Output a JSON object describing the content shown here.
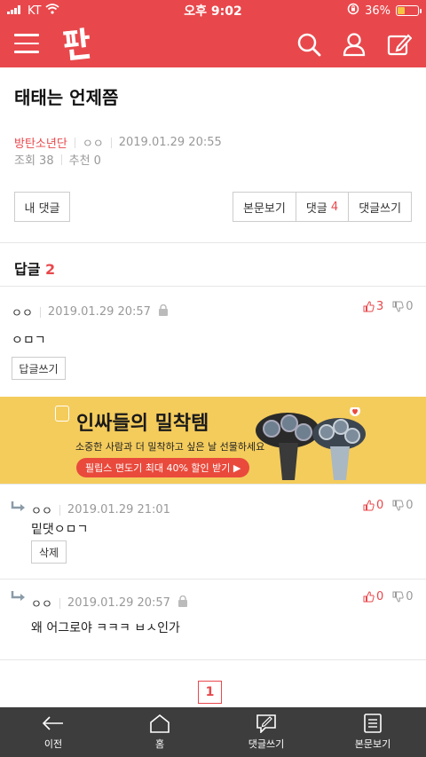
{
  "status": {
    "carrier": "KT",
    "time": "오후 9:02",
    "battery": "36%",
    "battery_level": 0.36
  },
  "post": {
    "title": "태태는 언제쯤",
    "category": "방탄소년단",
    "author": "ㅇㅇ",
    "datetime": "2019.01.29 20:55",
    "views": "조회 38",
    "recommends": "추천 0"
  },
  "actions": {
    "my_comments": "내 댓글",
    "view_post": "본문보기",
    "comments_label": "댓글",
    "comments_count": "4",
    "write_comment": "댓글쓰기"
  },
  "replies": {
    "label": "답글",
    "count": "2"
  },
  "comments": [
    {
      "author": "ㅇㅇ",
      "date": "2019.01.29 20:57",
      "up": "3",
      "down": "0",
      "body": "ㅇㅁㄱ",
      "button": "답글쓰기"
    },
    {
      "author": "ㅇㅇ",
      "date": "2019.01.29 21:01",
      "up": "0",
      "down": "0",
      "body": "밑댓ㅇㅁㄱ",
      "button": "삭제"
    },
    {
      "author": "ㅇㅇ",
      "date": "2019.01.29 20:57",
      "up": "0",
      "down": "0",
      "body": "왜 어그로야 ㅋㅋㅋ ㅂㅅ인가"
    }
  ],
  "ad": {
    "title": "인싸들의 밀착템",
    "subtitle": "소중한 사람과 더 밀착하고 싶은 날 선물하세요",
    "cta": "필립스 면도기 최대 40% 할인 받기 ▶"
  },
  "pagination": {
    "current": "1"
  },
  "tabbar": [
    {
      "label": "이전",
      "icon": "back-arrow-icon"
    },
    {
      "label": "홈",
      "icon": "home-icon"
    },
    {
      "label": "댓글쓰기",
      "icon": "write-comment-icon"
    },
    {
      "label": "본문보기",
      "icon": "document-icon"
    }
  ],
  "colors": {
    "brand": "#e8484c",
    "tabbar": "#3d3d3d",
    "ad_bg": "#f4cc5c"
  }
}
